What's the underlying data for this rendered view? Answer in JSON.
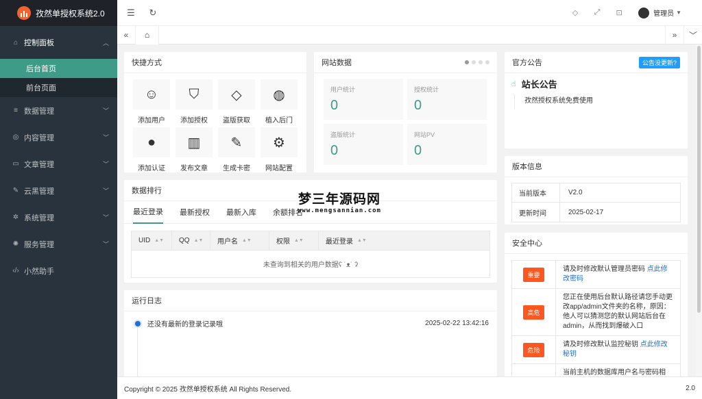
{
  "app": {
    "title": "孜然单授权系统2.0"
  },
  "sidebar": {
    "group": {
      "label": "控制面板",
      "icon": "home-icon"
    },
    "sub_items": [
      {
        "label": "后台首页",
        "active": true
      },
      {
        "label": "前台页面",
        "active": false
      }
    ],
    "items": [
      {
        "label": "数据管理",
        "icon": "database-icon"
      },
      {
        "label": "内容管理",
        "icon": "globe-icon"
      },
      {
        "label": "文章管理",
        "icon": "book-icon"
      },
      {
        "label": "云黑管理",
        "icon": "broom-icon"
      },
      {
        "label": "系统管理",
        "icon": "settings-icon"
      },
      {
        "label": "服务管理",
        "icon": "service-icon"
      },
      {
        "label": "小然助手",
        "icon": "code-icon"
      }
    ]
  },
  "header": {
    "user": "管理员"
  },
  "shortcuts": {
    "title": "快捷方式",
    "items": [
      {
        "label": "添加用户",
        "icon": "user-icon"
      },
      {
        "label": "添加授权",
        "icon": "shield-check-icon"
      },
      {
        "label": "盗版获取",
        "icon": "diamond-icon"
      },
      {
        "label": "植入后门",
        "icon": "palette-icon"
      },
      {
        "label": "添加认证",
        "icon": "compass-icon"
      },
      {
        "label": "发布文章",
        "icon": "open-book-icon"
      },
      {
        "label": "生成卡密",
        "icon": "edit-doc-icon"
      },
      {
        "label": "网站配置",
        "icon": "gear-icon"
      }
    ]
  },
  "site_data": {
    "title": "网站数据",
    "stats": [
      {
        "label": "用户统计",
        "value": "0"
      },
      {
        "label": "授权统计",
        "value": "0"
      },
      {
        "label": "盗版统计",
        "value": "0"
      },
      {
        "label": "网站PV",
        "value": "0"
      }
    ]
  },
  "ranking": {
    "title": "数据排行",
    "tabs": [
      "最近登录",
      "最新授权",
      "最新入库",
      "余额排名"
    ],
    "columns": [
      "UID",
      "QQ",
      "用户名",
      "权限",
      "最近登录"
    ],
    "empty": "未查询到相关的用户数据ʕ ˙ᴥ˙ ʔ"
  },
  "watermark": {
    "title": "梦三年源码网",
    "url": "www.mengsannian.com"
  },
  "log": {
    "title": "运行日志",
    "entries": [
      {
        "text": "还没有最新的登录记录哦",
        "time": "2025-02-22 13:42:16"
      }
    ]
  },
  "notice": {
    "title": "官方公告",
    "update_button": "公告没更新?",
    "heading": "站长公告",
    "body": "孜然授权系统免费使用"
  },
  "version": {
    "title": "版本信息",
    "rows": [
      {
        "k": "当前版本",
        "v": "V2.0"
      },
      {
        "k": "更新时间",
        "v": "2025-02-17"
      }
    ]
  },
  "security": {
    "title": "安全中心",
    "rows": [
      {
        "tag": "重要",
        "text": "请及时修改默认管理员密码 ",
        "link": "点此修改密码"
      },
      {
        "tag": "高危",
        "text": "您正在使用后台默认路径请您手动更改app/admin文件夹的名称，原因：他人可以猜测您的默认网站后台在admin，从而找到爆破入口",
        "link": ""
      },
      {
        "tag": "危险",
        "text": "请及时修改默认监控秘钥 ",
        "link": "点此修改秘钥"
      },
      {
        "tag": "",
        "text": "当前主机的数据库用户名与密码相",
        "link": ""
      }
    ]
  },
  "footer": {
    "copyright": "Copyright © 2025 孜然单授权系统 All Rights Reserved.",
    "version": "2.0"
  }
}
